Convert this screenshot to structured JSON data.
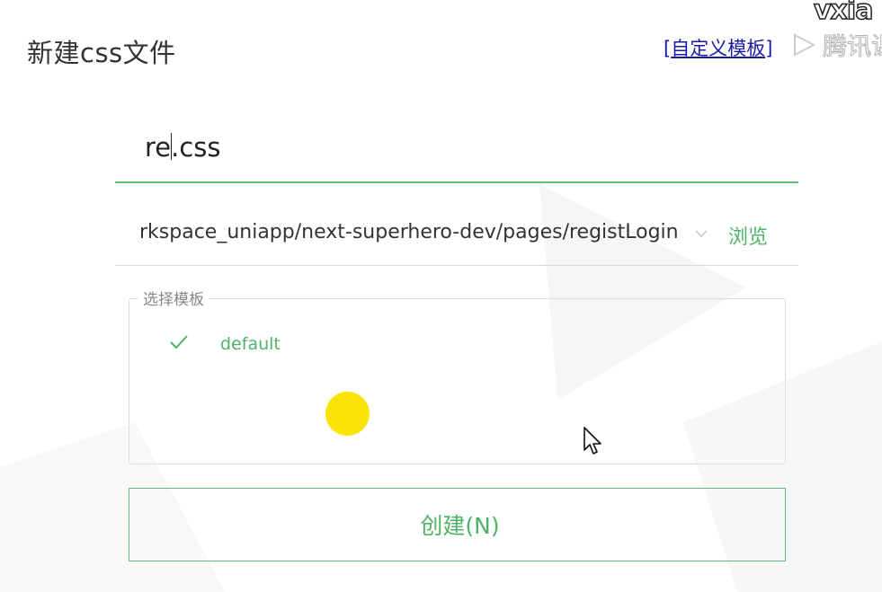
{
  "dialog": {
    "title": "新建css文件",
    "custom_template_link": "自定义模板",
    "link_bracket_open": "[",
    "link_bracket_close": "]"
  },
  "watermark": {
    "top_text": "vxia",
    "brand_text": "腾讯课"
  },
  "filename_input": {
    "value_before_caret": "re",
    "value_after_caret": ".css"
  },
  "path_input": {
    "value": "rkspace_uniapp/next-superhero-dev/pages/registLogin",
    "dropdown_icon": "chevron-down-icon",
    "browse_label": "浏览"
  },
  "template_section": {
    "legend": "选择模板",
    "items": [
      {
        "label": "default",
        "selected": true,
        "icon": "check-icon"
      }
    ]
  },
  "actions": {
    "create_label": "创建(N)"
  },
  "colors": {
    "accent_green": "#4fb366",
    "border_green": "#5dbe7a",
    "link_blue": "#1a1aa6",
    "highlight_yellow": "#f9e406"
  }
}
